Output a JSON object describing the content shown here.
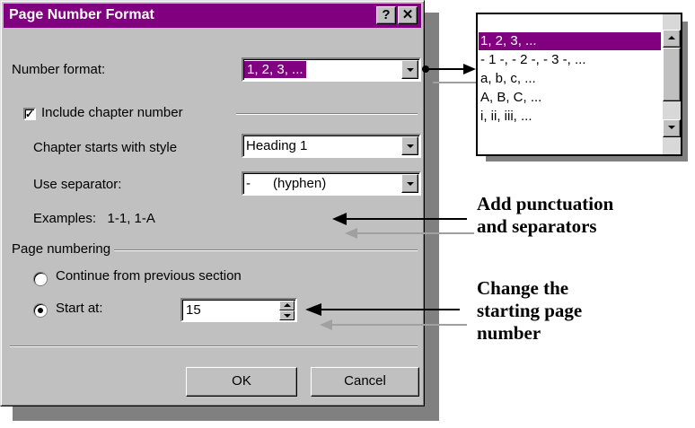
{
  "dialog": {
    "title": "Page Number Format",
    "help_button": "?",
    "close_button": "✕",
    "number_format": {
      "label": "Number format:",
      "value": "1, 2, 3, ..."
    },
    "include_chapter": {
      "label": "Include chapter number",
      "checked": true,
      "check_mark": "✓"
    },
    "chapter_style": {
      "label": "Chapter starts with style",
      "value": "Heading 1"
    },
    "separator": {
      "label": "Use separator:",
      "value": "-      (hyphen)"
    },
    "examples": "Examples:   1-1, 1-A",
    "page_numbering": {
      "group_label": "Page numbering",
      "continue_label": "Continue from previous section",
      "start_at_label": "Start at:",
      "start_at_value": "15"
    },
    "ok_label": "OK",
    "cancel_label": "Cancel"
  },
  "format_list": {
    "options": [
      "1, 2, 3, ...",
      "- 1 -, - 2 -, - 3 -, ...",
      "a, b, c, ...",
      "A, B, C, ...",
      "i, ii, iii, ..."
    ]
  },
  "annotations": {
    "punctuation_line1": "Add punctuation",
    "punctuation_line2": "and separators",
    "start_line1": "Change the",
    "start_line2": "starting page",
    "start_line3": "number"
  },
  "colors": {
    "selection": "#800080",
    "face": "#c0c0c0"
  }
}
